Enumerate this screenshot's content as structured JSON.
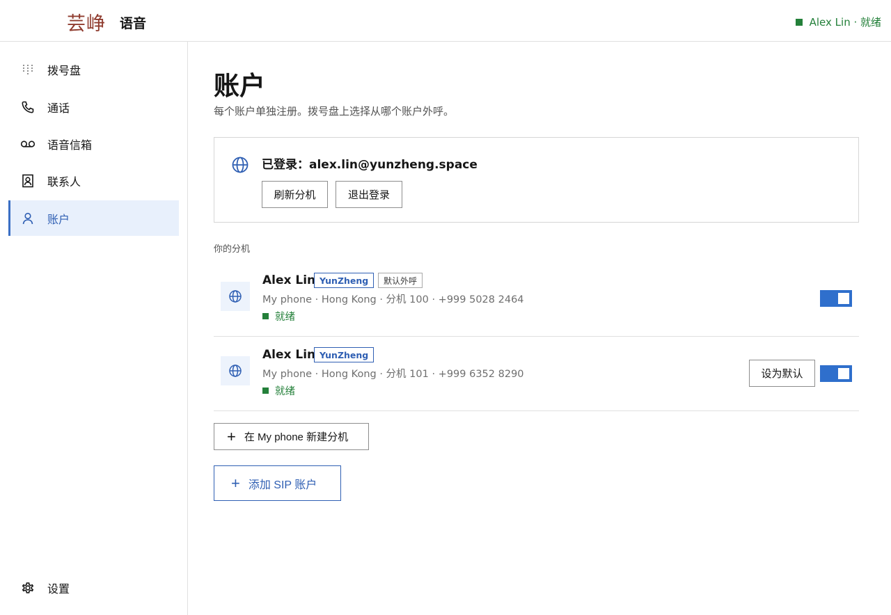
{
  "header": {
    "logo_text": "芸峥",
    "app_name": "语音",
    "status_user": "Alex Lin · 就绪",
    "status_color": "#24803a"
  },
  "sidebar": {
    "items": [
      {
        "label": "拨号盘",
        "icon": "dialpad-icon"
      },
      {
        "label": "通话",
        "icon": "phone-icon"
      },
      {
        "label": "语音信箱",
        "icon": "voicemail-icon"
      },
      {
        "label": "联系人",
        "icon": "contacts-icon"
      },
      {
        "label": "账户",
        "icon": "user-icon",
        "active": true
      }
    ],
    "settings_label": "设置"
  },
  "main": {
    "title": "账户",
    "subtitle": "每个账户单独注册。拨号盘上选择从哪个账户外呼。",
    "login": {
      "text": "已登录：alex.lin@yunzheng.space",
      "refresh_label": "刷新分机",
      "logout_label": "退出登录"
    },
    "extensions_label": "你的分机",
    "extensions": [
      {
        "name": "Alex Lin",
        "brand": "YunZheng",
        "default_tag": "默认外呼",
        "detail": "My phone · Hong Kong · 分机 100 · +999 5028 2464",
        "status": "就绪",
        "enabled": true
      },
      {
        "name": "Alex Lin",
        "brand": "YunZheng",
        "set_default_label": "设为默认",
        "detail": "My phone · Hong Kong · 分机 101 · +999 6352 8290",
        "status": "就绪",
        "enabled": true
      }
    ],
    "add_extension_label": "在 My phone 新建分机",
    "add_sip_label": "添加 SIP 账户"
  },
  "colors": {
    "accent": "#2f5fb3",
    "toggle": "#2f6fcc",
    "active_bg": "#e8f0fc",
    "brand": "#8f3b2e"
  }
}
